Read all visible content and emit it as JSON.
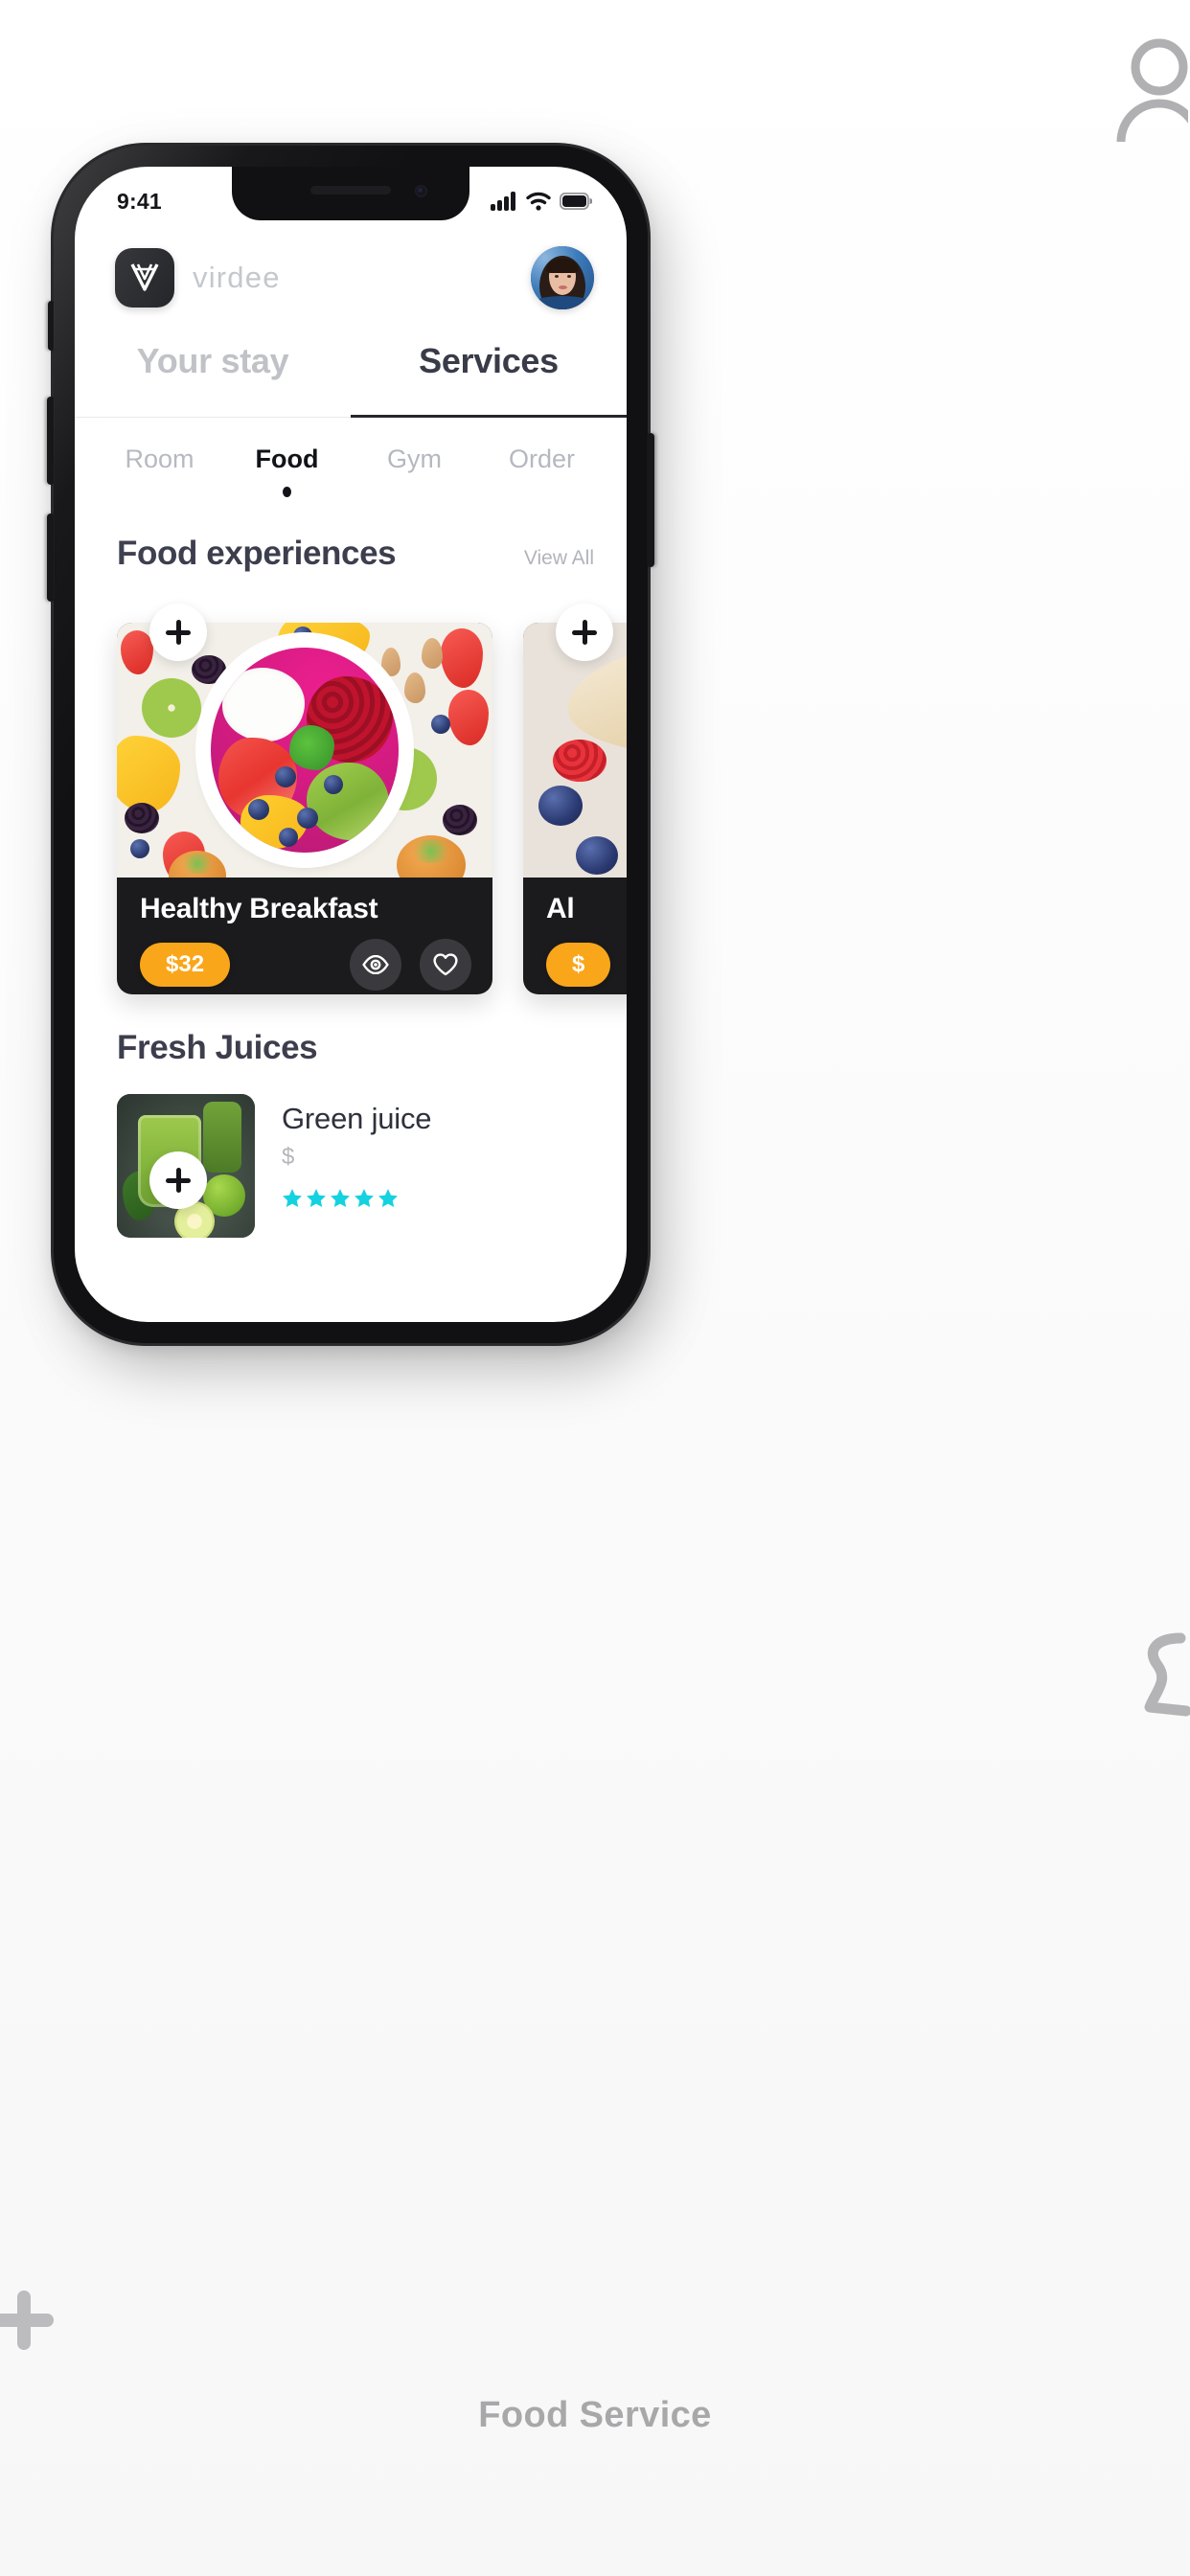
{
  "caption": "Food Service",
  "decorations": [
    {
      "name": "user-outline-icon",
      "position": "top-right"
    },
    {
      "name": "plus-icon",
      "position": "bottom-left"
    },
    {
      "name": "bell-outline-icon",
      "position": "mid-right"
    }
  ],
  "phone": {
    "status_bar": {
      "time": "9:41",
      "icons": [
        "cellular-signal-icon",
        "wifi-icon",
        "battery-icon"
      ]
    },
    "header": {
      "brand_name": "virdee",
      "brand_mark": "v-logo-icon",
      "avatar": "user-avatar"
    },
    "main_tabs": [
      {
        "label": "Your stay",
        "active": false
      },
      {
        "label": "Services",
        "active": true
      }
    ],
    "sub_tabs": [
      {
        "label": "Room",
        "active": false
      },
      {
        "label": "Food",
        "active": true
      },
      {
        "label": "Gym",
        "active": false
      },
      {
        "label": "Order",
        "active": false
      }
    ],
    "food_section": {
      "title": "Food experiences",
      "view_all": "View All",
      "cards": [
        {
          "title": "Healthy Breakfast",
          "price": "$32",
          "add_label": "+",
          "actions": [
            "eye-icon",
            "heart-icon"
          ]
        },
        {
          "title": "Al",
          "price": "$",
          "add_label": "+",
          "actions": [
            "eye-icon",
            "heart-icon"
          ]
        }
      ]
    },
    "juices_section": {
      "title": "Fresh Juices",
      "items": [
        {
          "name": "Green juice",
          "price": "$",
          "rating": 5,
          "add_label": "+",
          "star_color": "#14d2e0"
        }
      ]
    }
  },
  "colors": {
    "accent_orange": "#f9a61a",
    "star_cyan": "#14d2e0",
    "card_dark": "#1b1b1e",
    "text_dark": "#3c3e4d",
    "text_muted": "#b2b4bb"
  }
}
